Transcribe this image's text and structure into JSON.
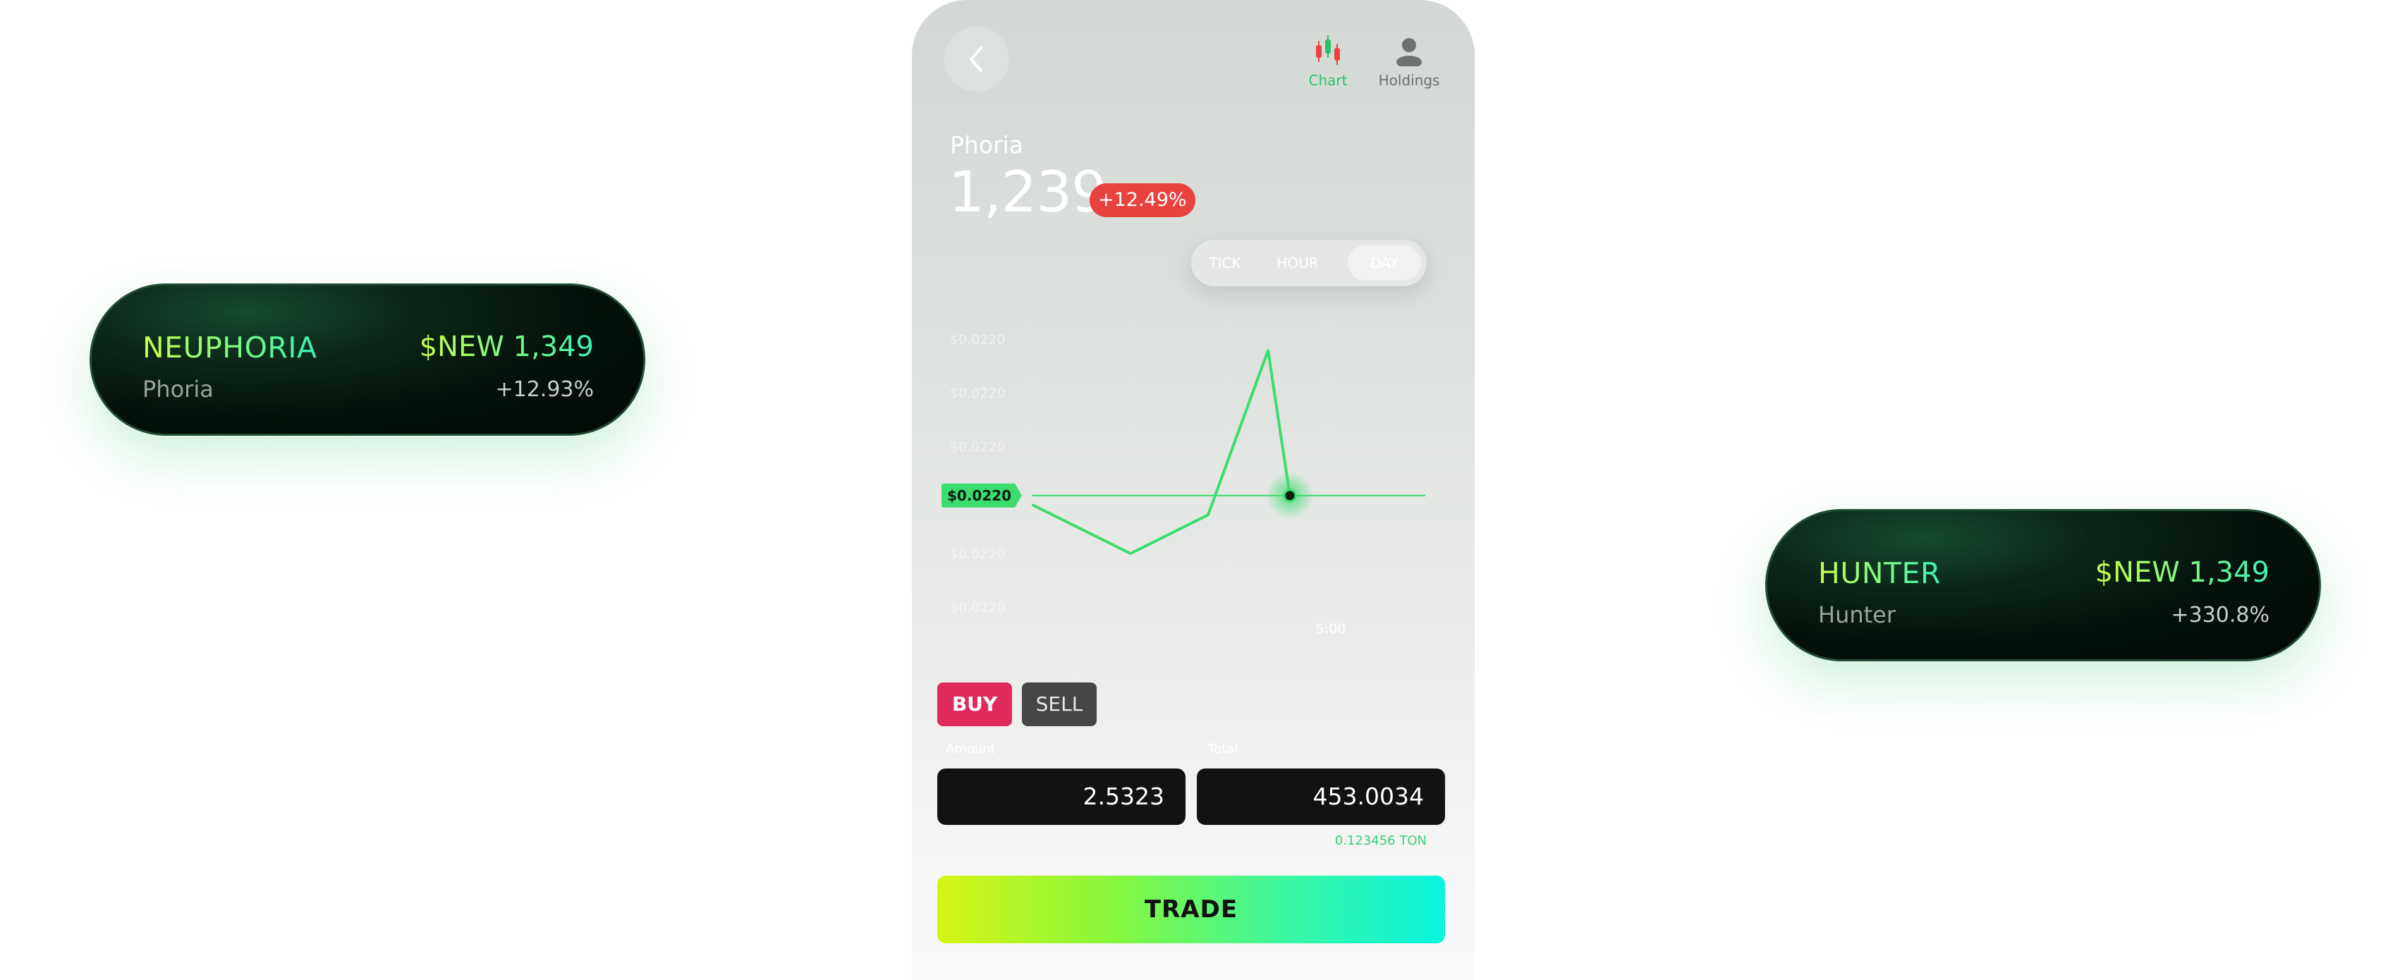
{
  "tickers": [
    {
      "name": "NEUPHORIA",
      "price": "$NEW 1,349",
      "sub": "Phoria",
      "change": "+12.93%"
    },
    {
      "name": "HUNTER",
      "price": "$NEW 1,349",
      "sub": "Hunter",
      "change": "+330.8%"
    }
  ],
  "nav": {
    "back_icon": "chevron-left-icon",
    "chart_label": "Chart",
    "holdings_label": "Holdings",
    "active": "Chart"
  },
  "asset": {
    "name": "Phoria",
    "price": "1,239",
    "change": "+12.49%"
  },
  "timeframe": {
    "tick": "TICK",
    "hour": "HOUR",
    "day": "DAY",
    "selected": "DAY"
  },
  "chart_data": {
    "type": "line",
    "y_tick_labels": [
      "$0.0220",
      "$0.0220",
      "$0.0220",
      "$0.0220",
      "$0.0220",
      "$0.0220"
    ],
    "x_tick_labels": [
      "",
      "",
      "",
      "5:00",
      ""
    ],
    "current_value_label": "$0.0220",
    "series": [
      {
        "values": [
          0.0219,
          0.0214,
          0.0218,
          0.0235,
          0.022
        ]
      }
    ],
    "reference_line": 0.022,
    "colors": {
      "line": "#3ddc6e",
      "badge": "#3ddc6e"
    }
  },
  "trade": {
    "buy_label": "BUY",
    "sell_label": "SELL",
    "selected": "BUY",
    "amount_label": "Amount",
    "total_label": "Total",
    "amount_value": "2.5323",
    "total_value": "453.0034",
    "ton_value": "0.123456 TON",
    "submit_label": "TRADE"
  },
  "colors": {
    "accent_green": "#29c26a",
    "change_red": "#e8423f",
    "buy_red": "#e02a5c"
  }
}
